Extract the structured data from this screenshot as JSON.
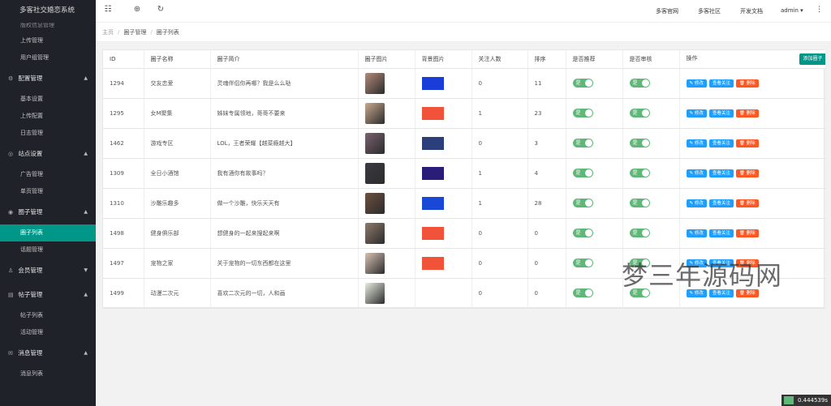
{
  "app_title": "多客社交婚恋系统",
  "sidebar": {
    "top_items": [
      "版权信息管理",
      "上传管理",
      "用户组管理"
    ],
    "groups": [
      {
        "label": "配置管理",
        "icon": "gear-icon",
        "glyph": "⚙",
        "arrow": "▲",
        "items": [
          "基本设置",
          "上传配置",
          "日志管理"
        ]
      },
      {
        "label": "站点设置",
        "icon": "site-icon",
        "glyph": "◎",
        "arrow": "▲",
        "items": [
          "广告管理",
          "单页管理"
        ]
      },
      {
        "label": "圈子管理",
        "icon": "circle-icon",
        "glyph": "◉",
        "arrow": "▲",
        "items": [
          "圈子列表",
          "话题管理"
        ]
      },
      {
        "label": "会员管理",
        "icon": "user-icon",
        "glyph": "♙",
        "arrow": "▼",
        "items": []
      },
      {
        "label": "帖子管理",
        "icon": "post-icon",
        "glyph": "▤",
        "arrow": "▲",
        "items": [
          "帖子列表",
          "活动管理"
        ]
      },
      {
        "label": "消息管理",
        "icon": "message-icon",
        "glyph": "✉",
        "arrow": "▲",
        "items": [
          "消息列表"
        ]
      }
    ],
    "active_item": "圈子列表"
  },
  "topbar": {
    "links": [
      "多客官网",
      "多客社区",
      "开发文档"
    ],
    "user": "admin",
    "icons": {
      "collapse": "☷",
      "globe": "⊕",
      "refresh": "↻",
      "more": "⋮",
      "caret": "▾"
    }
  },
  "breadcrumb": [
    "主页",
    "圈子管理",
    "圈子列表"
  ],
  "table": {
    "add_button": "添加圈子",
    "headers": [
      "ID",
      "圈子名称",
      "圈子简介",
      "圈子图片",
      "背景图片",
      "关注人数",
      "排序",
      "是否推荐",
      "是否审核",
      "操作"
    ],
    "switch_label": "是",
    "actions": {
      "edit": "✎ 修改",
      "view": "查看关注",
      "del": "🗑 删除"
    },
    "rows": [
      {
        "id": "1294",
        "name": "交友恋爱",
        "intro": "灵魂伴侣你再哪？我是么么哒",
        "follows": "0",
        "sort": "11",
        "thumb_color": "#b38a7a",
        "bg_color": "#1a3cd8"
      },
      {
        "id": "1295",
        "name": "女M聚集",
        "intro": "姊妹专属领地，哥哥不要来",
        "follows": "1",
        "sort": "23",
        "thumb_color": "#c9a98f",
        "bg_color": "#f0533a"
      },
      {
        "id": "1462",
        "name": "游戏专区",
        "intro": "LOL，王者荣耀【越菜瘾越大】",
        "follows": "0",
        "sort": "3",
        "thumb_color": "#7a6270",
        "bg_color": "#2c3f7a"
      },
      {
        "id": "1309",
        "name": "全日小酒馆",
        "intro": "我有酒你有故事吗？",
        "follows": "1",
        "sort": "4",
        "thumb_color": "#3c3a44",
        "bg_color": "#2a1d7a"
      },
      {
        "id": "1310",
        "name": "沙雕乐趣多",
        "intro": "做一个沙雕，快乐天天有",
        "follows": "1",
        "sort": "28",
        "thumb_color": "#6d5140",
        "bg_color": "#1a48d6"
      },
      {
        "id": "1498",
        "name": "健身俱乐部",
        "intro": "想健身的一起来搜起来啊",
        "follows": "0",
        "sort": "0",
        "thumb_color": "#8f7a6a",
        "bg_color": "#f0533a"
      },
      {
        "id": "1497",
        "name": "宠物之家",
        "intro": "关于宠物的一切东西都在这里",
        "follows": "0",
        "sort": "0",
        "thumb_color": "#d7c2b5",
        "bg_color": "#f0533a"
      },
      {
        "id": "1499",
        "name": "动漫二次元",
        "intro": "喜欢二次元的一切，人和画",
        "follows": "0",
        "sort": "0",
        "thumb_color": "#e8ede0",
        "bg_color": ""
      }
    ]
  },
  "watermark": "梦三年源码网",
  "corner_value": "0.444539s"
}
